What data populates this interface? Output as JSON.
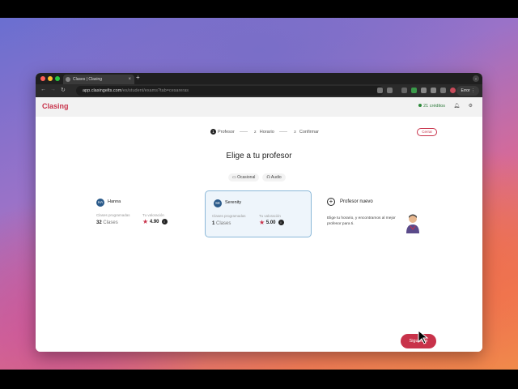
{
  "browser": {
    "tab_title": "Clases | Clasing",
    "url_host": "app.clasingelts.com",
    "url_path": "/es/student/exams?tab=cesareras",
    "error_label": "Error"
  },
  "app": {
    "logo": "Clasing",
    "credits": "21 créditos"
  },
  "modal": {
    "close_label": "Cerrar",
    "steps": [
      {
        "num": "1",
        "label": "Profesor"
      },
      {
        "num": "2",
        "label": "Horario"
      },
      {
        "num": "3",
        "label": "Confirmar"
      }
    ],
    "title": "Elige a tu profesor",
    "filters": [
      "Ocasional",
      "Audio"
    ],
    "teachers": [
      {
        "initials": "HA",
        "name": "Hanna",
        "classes_label": "Clases programadas",
        "classes_value": "32",
        "classes_unit": "Clases",
        "rating_label": "Tu valoración",
        "rating": "4.90"
      },
      {
        "initials": "SE",
        "name": "Serenity",
        "classes_label": "Clases programadas",
        "classes_value": "1",
        "classes_unit": "Clases",
        "rating_label": "Tu valoración",
        "rating": "5.00"
      }
    ],
    "new_teacher": {
      "title": "Profesor nuevo",
      "description": "Elige tu horario, y encontramos al mejor profesor para ti."
    },
    "next_label": "Siguiente"
  }
}
